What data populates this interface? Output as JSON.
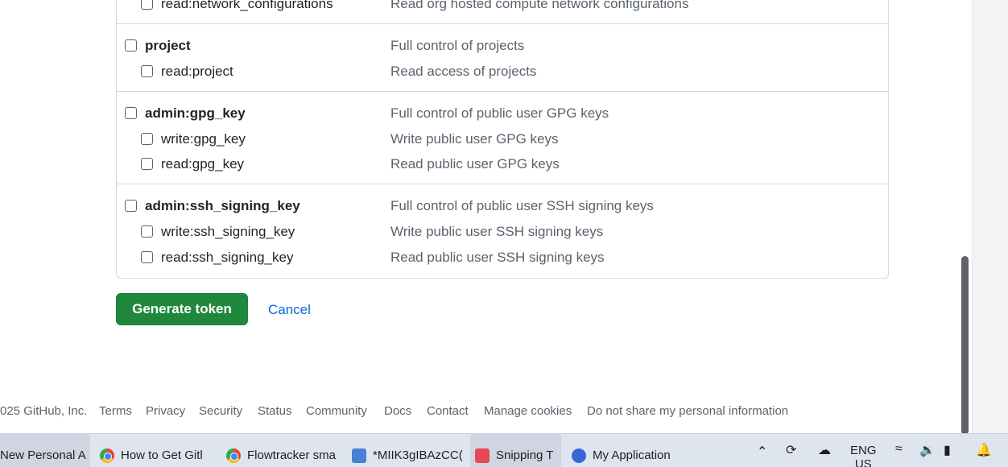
{
  "scopes": [
    {
      "rows": [
        {
          "name": "read:network_configurations",
          "desc": "Read org hosted compute network configurations",
          "child": true
        }
      ]
    },
    {
      "rows": [
        {
          "name": "project",
          "desc": "Full control of projects",
          "child": false
        },
        {
          "name": "read:project",
          "desc": "Read access of projects",
          "child": true
        }
      ]
    },
    {
      "rows": [
        {
          "name": "admin:gpg_key",
          "desc": "Full control of public user GPG keys",
          "child": false
        },
        {
          "name": "write:gpg_key",
          "desc": "Write public user GPG keys",
          "child": true
        },
        {
          "name": "read:gpg_key",
          "desc": "Read public user GPG keys",
          "child": true
        }
      ]
    },
    {
      "rows": [
        {
          "name": "admin:ssh_signing_key",
          "desc": "Full control of public user SSH signing keys",
          "child": false
        },
        {
          "name": "write:ssh_signing_key",
          "desc": "Write public user SSH signing keys",
          "child": true
        },
        {
          "name": "read:ssh_signing_key",
          "desc": "Read public user SSH signing keys",
          "child": true
        }
      ]
    }
  ],
  "actions": {
    "generate_label": "Generate token",
    "cancel_label": "Cancel"
  },
  "footer": {
    "copyright": "025 GitHub, Inc.",
    "links": [
      "Terms",
      "Privacy",
      "Security",
      "Status",
      "Community",
      "Docs",
      "Contact",
      "Manage cookies",
      "Do not share my personal information"
    ]
  },
  "taskbar": {
    "items": [
      {
        "label": "New Personal A",
        "icon": "chrome-icon"
      },
      {
        "label": "How to Get Gitl",
        "icon": "chrome-icon"
      },
      {
        "label": "Flowtracker sma",
        "icon": "chrome-icon"
      },
      {
        "label": "*MIIK3gIBAzCC(",
        "icon": "notepad-icon"
      },
      {
        "label": "Snipping T",
        "icon": "snipping-tool-icon"
      },
      {
        "label": "My Application",
        "icon": "app-icon"
      }
    ],
    "tray": {
      "lang_top": "ENG",
      "lang_bottom": "US"
    }
  },
  "colors": {
    "primary_button": "#1f883d",
    "link": "#0969da",
    "muted_text": "#59636e"
  }
}
